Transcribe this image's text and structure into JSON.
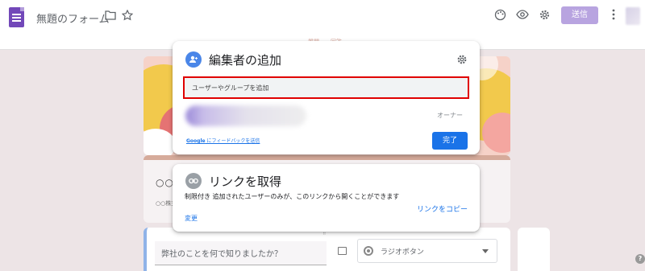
{
  "header": {
    "title": "無題のフォーム",
    "send_label": "送信",
    "icons": [
      "forms-icon",
      "folder-icon",
      "star-icon",
      "palette-icon",
      "eye-icon",
      "gear-icon",
      "more-vert-icon"
    ]
  },
  "subheader": {
    "tab_peek_left": "質問",
    "tab_peek_right": "回答"
  },
  "form_card": {
    "title": "○○",
    "subtitle": "○○株式"
  },
  "question": {
    "placeholder": "弊社のことを何で知りましたか？",
    "type_label": "ラジオボタン"
  },
  "add_editors_dialog": {
    "title": "編集者の追加",
    "input_placeholder": "ユーザーやグループを追加",
    "owner_role": "オーナー",
    "feedback_brand": "Google",
    "feedback_text": " にフィードバックを送信",
    "done_label": "完了"
  },
  "link_dialog": {
    "title": "リンクを取得",
    "description": "制限付き 追加されたユーザーのみが、このリンクから開くことができます",
    "change_label": "変更",
    "copy_label": "リンクをコピー"
  },
  "colors": {
    "accent_blue": "#1a73e8",
    "highlight_red": "#e00000",
    "forms_purple": "#7248b9"
  }
}
